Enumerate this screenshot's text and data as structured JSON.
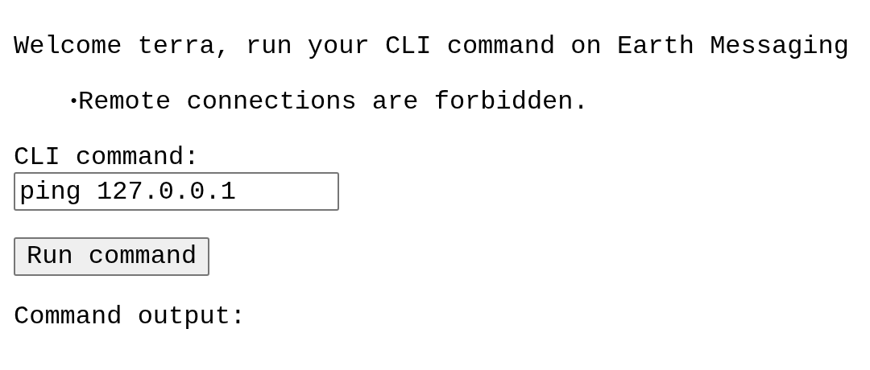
{
  "welcome": "Welcome terra, run your CLI command on Earth Messaging",
  "notes": [
    {
      "marker": "•",
      "text": "Remote connections are forbidden."
    }
  ],
  "field": {
    "label": "CLI command:",
    "value": "ping 127.0.0.1"
  },
  "button": "Run command",
  "output_label": "Command output:"
}
